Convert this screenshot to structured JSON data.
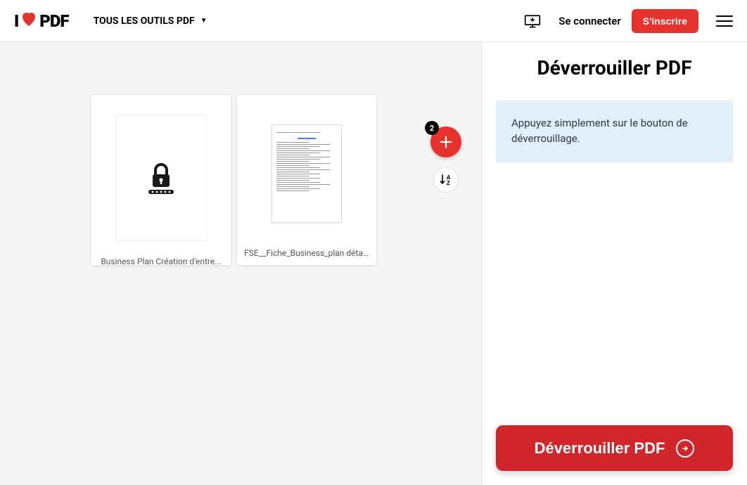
{
  "header": {
    "logo_prefix": "I",
    "logo_suffix": "PDF",
    "tools_label": "TOUS LES OUTILS PDF",
    "signin": "Se connecter",
    "signup": "S'inscrire"
  },
  "workspace": {
    "files": [
      {
        "name": "Business Plan Création d'entre...",
        "locked": true
      },
      {
        "name": "FSE__Fiche_Business_plan déta...",
        "locked": false
      }
    ],
    "file_count_badge": "2",
    "sort_label": "A\nZ"
  },
  "panel": {
    "title": "Déverrouiller PDF",
    "hint": "Appuyez simplement sur le bouton de déverrouillage.",
    "action_label": "Déverrouiller PDF"
  }
}
